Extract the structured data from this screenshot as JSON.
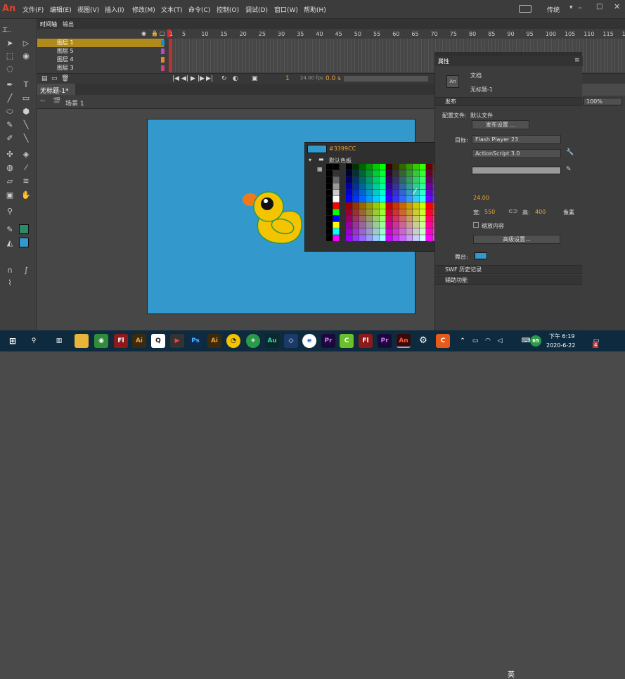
{
  "app": {
    "logo": "An"
  },
  "menu": [
    "文件(F)",
    "编辑(E)",
    "视图(V)",
    "插入(I)",
    "修改(M)",
    "文本(T)",
    "命令(C)",
    "控制(O)",
    "调试(D)",
    "窗口(W)",
    "帮助(H)"
  ],
  "workspace": "传统",
  "tools_label": "工..",
  "timeline": {
    "tabs": [
      "时间轴",
      "输出"
    ],
    "layers": [
      "图层 1",
      "图层 5",
      "图层 4",
      "图层 3"
    ],
    "ruler": [
      "1",
      "5",
      "10",
      "15",
      "20",
      "25",
      "30",
      "35",
      "40",
      "45",
      "50",
      "55",
      "60",
      "65",
      "70",
      "75",
      "80",
      "85",
      "90",
      "95",
      "100",
      "105",
      "110",
      "115",
      "1"
    ],
    "frame": "1",
    "fps": "24.00 fps",
    "time": "0.0 s"
  },
  "document": {
    "tab": "无标题-1*",
    "scene": "场景 1",
    "zoom": "100%"
  },
  "properties": {
    "tab": "属性",
    "doc_type": "文档",
    "doc_name": "无标题-1",
    "publish_section": "发布",
    "profile_label": "配置文件:",
    "profile_value": "默认文件",
    "publish_settings_btn": "发布设置 ...",
    "target_label": "目标:",
    "target_value": "Flash Player 23",
    "script_value": "ActionScript 3.0",
    "fps_partial": "24.00",
    "width_label": "宽:",
    "width_value": "550",
    "height_label": "高:",
    "height_value": "400",
    "unit": "像素",
    "scale_content": "缩放内容",
    "advanced_btn": "高级设置...",
    "stage_label": "舞台:",
    "swf_history": "SWF 历史记录",
    "accessibility": "辅助功能"
  },
  "color_picker": {
    "hex": "#3399CC",
    "palette_label": "默认色板",
    "selected_color": "#3399cc"
  },
  "taskbar": {
    "time": "下午 6:19",
    "date": "2020-6-22",
    "ime": "英",
    "badge": "65",
    "notify": "4"
  }
}
